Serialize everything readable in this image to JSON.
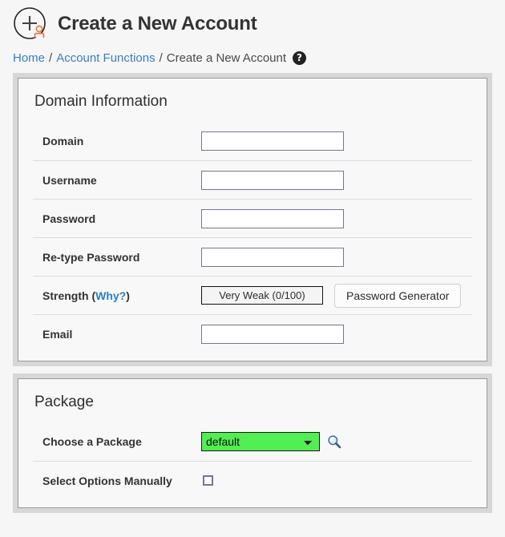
{
  "header": {
    "title": "Create a New Account",
    "icon": "add-user-icon"
  },
  "breadcrumb": {
    "items": [
      {
        "label": "Home",
        "link": true
      },
      {
        "label": "Account Functions",
        "link": true
      },
      {
        "label": "Create a New Account",
        "link": false
      }
    ],
    "separator": "/",
    "help_icon": "question-mark-icon",
    "help_label": "?"
  },
  "colors": {
    "link": "#3a7ec1",
    "accent_orange": "#e8703a",
    "select_green": "#51ef51",
    "page_background": "#f6f6f6",
    "panel_background": "#f8f8f8",
    "panel_outer": "#d7d7d7"
  },
  "panels": [
    {
      "id": "domain-information",
      "title": "Domain Information",
      "rows": [
        {
          "id": "domain",
          "label": "Domain",
          "type": "text",
          "value": "",
          "placeholder": ""
        },
        {
          "id": "username",
          "label": "Username",
          "type": "text",
          "value": "",
          "placeholder": ""
        },
        {
          "id": "password",
          "label": "Password",
          "type": "password",
          "value": "",
          "placeholder": ""
        },
        {
          "id": "retype",
          "label": "Re-type Password",
          "type": "password",
          "value": "",
          "placeholder": ""
        },
        {
          "id": "strength",
          "label": "Strength",
          "type": "strength",
          "label_suffix_open": " (",
          "label_link": "Why?",
          "label_suffix_close": ")",
          "strength_value": "Very Weak (0/100)",
          "generator_button": "Password Generator"
        },
        {
          "id": "email",
          "label": "Email",
          "type": "text",
          "value": "",
          "placeholder": ""
        }
      ]
    },
    {
      "id": "package",
      "title": "Package",
      "rows": [
        {
          "id": "choose-package",
          "label": "Choose a Package",
          "type": "select",
          "selected": "default",
          "options": [
            "default"
          ],
          "search_icon": "magnifier-icon"
        },
        {
          "id": "select-options-manually",
          "label": "Select Options Manually",
          "type": "checkbox",
          "checked": false
        }
      ]
    }
  ]
}
